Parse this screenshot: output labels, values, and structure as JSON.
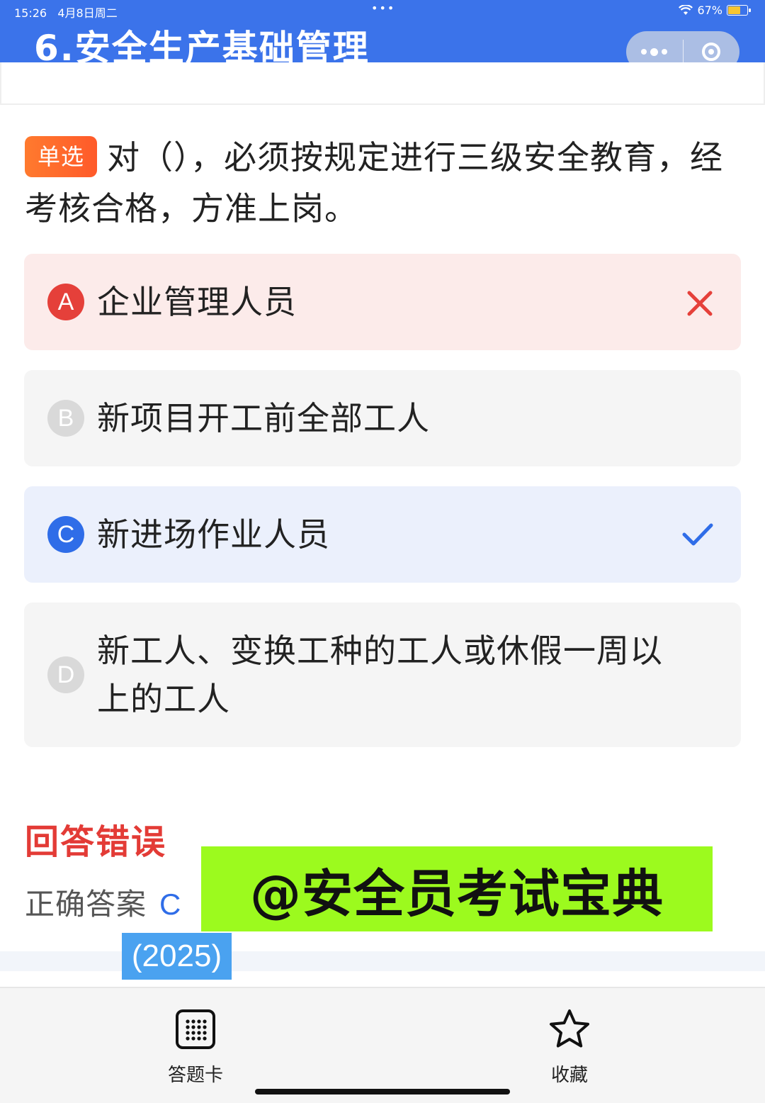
{
  "status_bar": {
    "time": "15:26",
    "date": "4月8日周二",
    "center_dots": "•••",
    "battery_percent": "67%",
    "battery_level": 0.67
  },
  "header": {
    "title": "6.安全生产基础管理"
  },
  "question": {
    "type_tag": "单选",
    "text": "对（），必须按规定进行三级安全教育，经考核合格，方准上岗。"
  },
  "options": [
    {
      "key": "A",
      "text": "企业管理人员",
      "state": "wrong",
      "mark_icon": "cross-icon"
    },
    {
      "key": "B",
      "text": "新项目开工前全部工人",
      "state": "normal"
    },
    {
      "key": "C",
      "text": "新进场作业人员",
      "state": "correct",
      "mark_icon": "check-icon"
    },
    {
      "key": "D",
      "text": "新工人、变换工种的工人或休假一周以上的工人",
      "state": "normal"
    }
  ],
  "result": {
    "status": "回答错误",
    "correct_label": "正确答案",
    "correct_value": "C"
  },
  "overlay": {
    "watermark": "@安全员考试宝典",
    "year": "(2025)"
  },
  "bottom_nav": {
    "answer_card": "答题卡",
    "favorite": "收藏"
  },
  "colors": {
    "header_blue": "#3b73ea",
    "wrong_red": "#e5403a",
    "correct_blue": "#2f6de8",
    "tag_orange": "#ff6a2c",
    "watermark_green": "#9cfa1e"
  }
}
